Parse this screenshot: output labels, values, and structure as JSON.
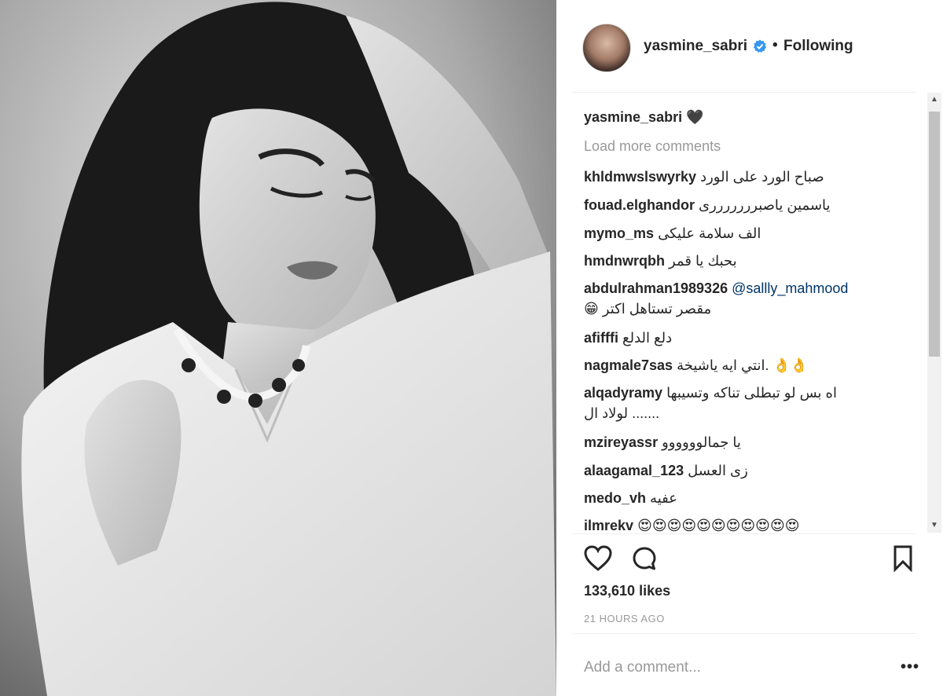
{
  "post": {
    "username": "yasmine_sabri",
    "follow_state": "Following",
    "dot": "•",
    "verified_icon": "verified-badge-icon",
    "accent_color": "#3897f0"
  },
  "caption": {
    "username": "yasmine_sabri",
    "text": "🖤"
  },
  "load_more": "Load more comments",
  "comments": [
    {
      "user": "khldmwslswyrky",
      "text": "صباح الورد على الورد"
    },
    {
      "user": "fouad.elghandor",
      "text": "ياسمين ياصبرررررررى"
    },
    {
      "user": "mymo_ms",
      "text": "الف سلامة عليكى"
    },
    {
      "user": "hmdnwrqbh",
      "text": "بحبك يا قمر"
    },
    {
      "user": "abdulrahman1989326",
      "mention": "@sallly_mahmood",
      "text2": "😁 مقصر تستاهل اكتر"
    },
    {
      "user": "afifffi",
      "text": "دلع الدلع"
    },
    {
      "user": "nagmale7sas",
      "text": "انتي ايه ياشيخة. 👌👌"
    },
    {
      "user": "alqadyramy",
      "text": "اه بس لو تبطلى تناكه وتسيبها",
      "text2": "لولاد ال ......."
    },
    {
      "user": "mzireyassr",
      "text": "يا جمالوووووو"
    },
    {
      "user": "alaagamal_123",
      "text": "زى العسل"
    },
    {
      "user": "medo_vh",
      "text": "عفيه"
    },
    {
      "user": "ilmrekv",
      "text": "😍😍😍😍😍😍😍😍😍😍😍"
    }
  ],
  "actions": {
    "like_icon": "heart-icon",
    "comment_icon": "comment-icon",
    "save_icon": "bookmark-icon"
  },
  "likes": "133,610 likes",
  "time_ago": "21 HOURS AGO",
  "add_comment_placeholder": "Add a comment...",
  "more_options": "•••"
}
